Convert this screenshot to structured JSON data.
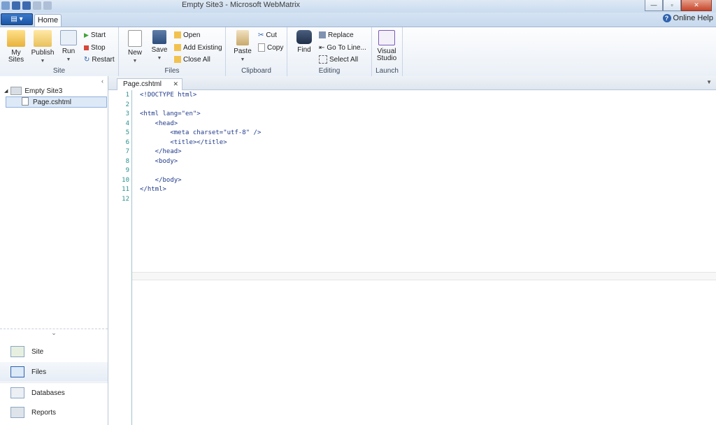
{
  "window": {
    "title": "Empty Site3 - Microsoft WebMatrix",
    "controls": [
      "minimize",
      "maximize",
      "close"
    ]
  },
  "ribbon": {
    "tab": "Home",
    "help": "Online Help",
    "groups": {
      "site": {
        "label": "Site",
        "my_sites": "My\nSites",
        "publish": "Publish",
        "run": "Run",
        "start": "Start",
        "stop": "Stop",
        "restart": "Restart"
      },
      "files": {
        "label": "Files",
        "new": "New",
        "save": "Save",
        "open": "Open",
        "add_existing": "Add Existing",
        "close_all": "Close All"
      },
      "clipboard": {
        "label": "Clipboard",
        "paste": "Paste",
        "cut": "Cut",
        "copy": "Copy"
      },
      "editing": {
        "label": "Editing",
        "find": "Find",
        "replace": "Replace",
        "go_to_line": "Go To Line...",
        "select_all": "Select All"
      },
      "launch": {
        "label": "Launch",
        "visual_studio": "Visual\nStudio"
      }
    }
  },
  "tree": {
    "root": "Empty Site3",
    "file": "Page.cshtml"
  },
  "workspaces": [
    "Site",
    "Files",
    "Databases",
    "Reports"
  ],
  "editor": {
    "tab": "Page.cshtml",
    "line_numbers": [
      "1",
      "2",
      "3",
      "4",
      "5",
      "6",
      "7",
      "8",
      "9",
      "10",
      "11",
      "12"
    ],
    "lines": [
      "<!DOCTYPE html>",
      "",
      "<html lang=\"en\">",
      "    <head>",
      "        <meta charset=\"utf-8\" />",
      "        <title></title>",
      "    </head>",
      "    <body>",
      "",
      "    </body>",
      "</html>",
      ""
    ]
  },
  "colors": {
    "ribbon_bg": "#eaf0f7",
    "accent": "#2e62ad",
    "gutter_number": "#2b8f8f"
  }
}
